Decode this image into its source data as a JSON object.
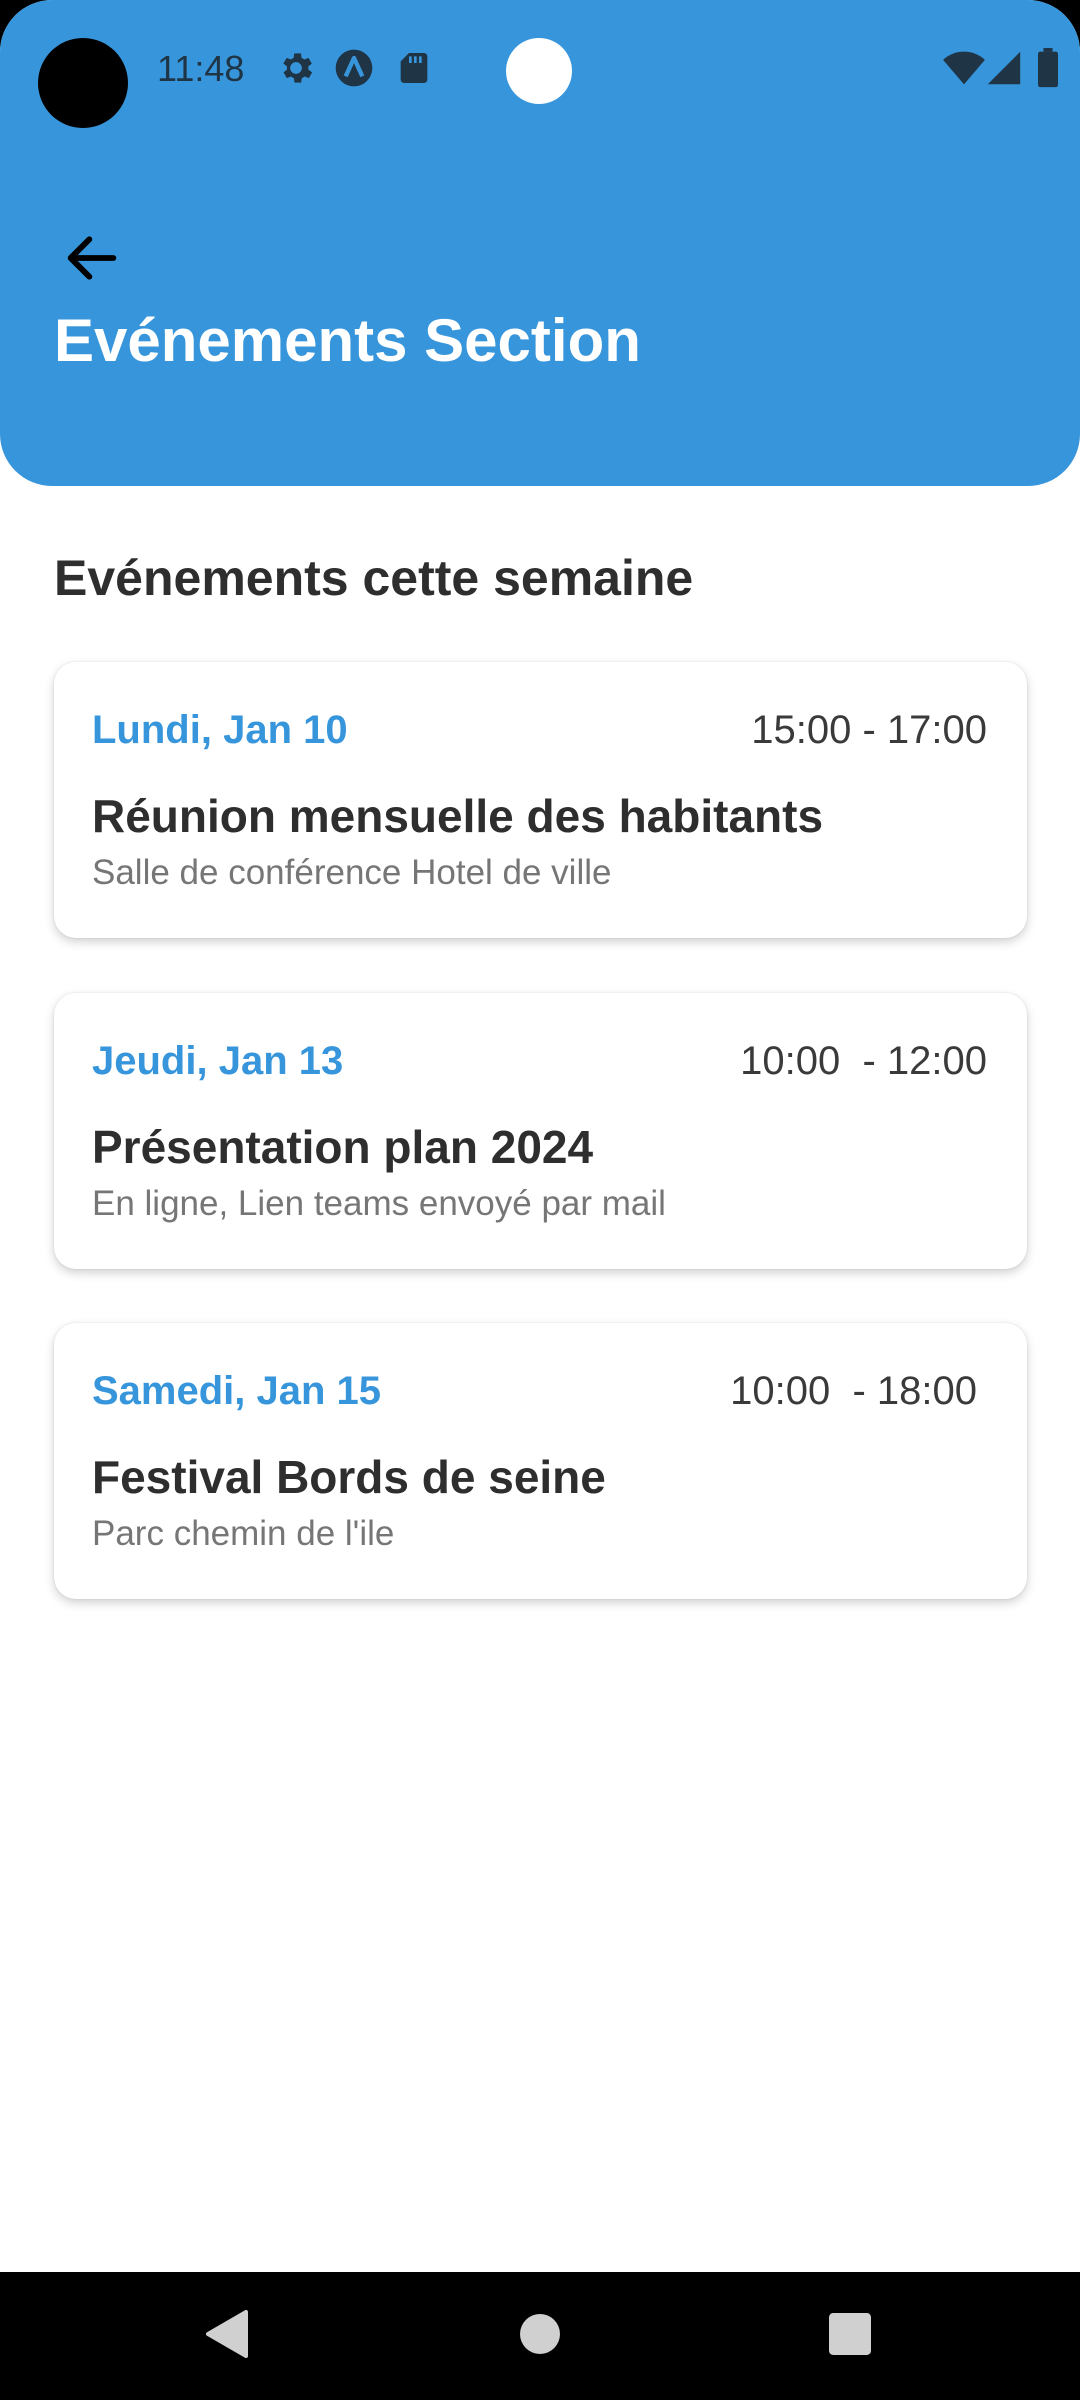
{
  "status_bar": {
    "time": "11:48",
    "icons": [
      "gear-icon",
      "a-badge-icon",
      "sd-card-icon",
      "wifi-icon",
      "cellular-signal-icon",
      "battery-icon"
    ]
  },
  "header": {
    "back_icon": "arrow-left-icon",
    "title": "Evénements Section",
    "background_color": "#3796db"
  },
  "main": {
    "section_title": "Evénements cette semaine",
    "events": [
      {
        "date": "Lundi, Jan 10",
        "time": "15:00 - 17:00",
        "title": "Réunion mensuelle des habitants",
        "location": "Salle de conférence Hotel de ville"
      },
      {
        "date": "Jeudi, Jan 13",
        "time": "10:00  - 12:00",
        "title": "Présentation plan 2024",
        "location": "En ligne, Lien teams envoyé par mail"
      },
      {
        "date": "Samedi, Jan 15",
        "time": "10:00  - 18:00",
        "title": "Festival Bords de seine",
        "location": "Parc chemin de l'ile"
      }
    ]
  },
  "nav_bar": {
    "icons": [
      "back-triangle-icon",
      "home-circle-icon",
      "recents-square-icon"
    ]
  },
  "colors": {
    "accent": "#3796db",
    "title_text": "#2e2e2e",
    "secondary_text": "#767676"
  }
}
